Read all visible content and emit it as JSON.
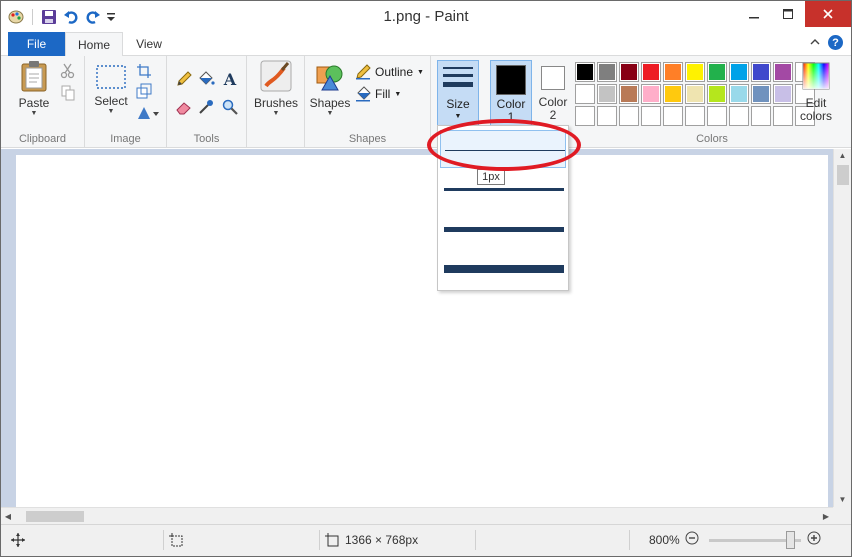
{
  "window": {
    "title": "1.png - Paint"
  },
  "tabs": {
    "file": "File",
    "home": "Home",
    "view": "View"
  },
  "ribbon": {
    "clipboard": {
      "label": "Clipboard",
      "paste": "Paste"
    },
    "image": {
      "label": "Image",
      "select": "Select"
    },
    "tools": {
      "label": "Tools"
    },
    "brushes": {
      "label": "Brushes"
    },
    "shapes": {
      "label": "Shapes",
      "shapes_btn": "Shapes",
      "outline": "Outline",
      "fill": "Fill"
    },
    "size": {
      "label": "Size"
    },
    "color1": {
      "label": "Color",
      "sub": "1"
    },
    "color2": {
      "label": "Color",
      "sub": "2"
    },
    "colors": {
      "label": "Colors",
      "edit_colors": "Edit",
      "edit_colors2": "colors"
    }
  },
  "palette": [
    "#000000",
    "#7f7f7f",
    "#880015",
    "#ed1c24",
    "#ff7f27",
    "#fff200",
    "#22b14c",
    "#00a2e8",
    "#3f48cc",
    "#a349a4",
    "#ffffff",
    "#ffffff",
    "#c3c3c3",
    "#b97a57",
    "#ffaec9",
    "#ffc90e",
    "#efe4b0",
    "#b5e61d",
    "#99d9ea",
    "#7092be",
    "#c8bfe7",
    "#ffffff",
    "#ffffff",
    "#ffffff",
    "#ffffff",
    "#ffffff",
    "#ffffff",
    "#ffffff",
    "#ffffff",
    "#ffffff",
    "#ffffff",
    "#ffffff",
    "#ffffff"
  ],
  "size_dropdown": {
    "tooltip": "1px",
    "options": [
      {
        "thickness": 1,
        "hover": true
      },
      {
        "thickness": 3,
        "hover": false
      },
      {
        "thickness": 5,
        "hover": false
      },
      {
        "thickness": 8,
        "hover": false
      }
    ]
  },
  "statusbar": {
    "dimensions": "1366 × 768px",
    "zoom": "800%"
  }
}
